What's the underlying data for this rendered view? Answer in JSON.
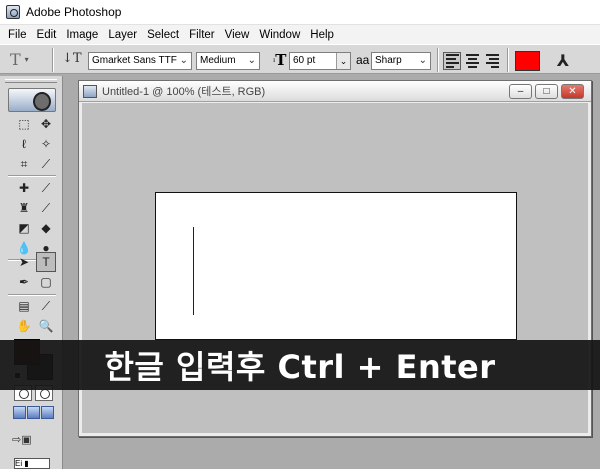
{
  "app": {
    "title": "Adobe Photoshop"
  },
  "menu": [
    "File",
    "Edit",
    "Image",
    "Layer",
    "Select",
    "Filter",
    "View",
    "Window",
    "Help"
  ],
  "options": {
    "tool_preset_glyph": "T",
    "orientation_glyph": "↓T",
    "font_family": "Gmarket Sans TTF",
    "font_style": "Medium",
    "size_glyph": "T",
    "font_size": "60 pt",
    "aa_glyph": "aa",
    "antialias": "Sharp",
    "text_color": "#ff0000",
    "warp_glyph": "⅄"
  },
  "document": {
    "title": "Untitled-1 @ 100% (테스트, RGB)",
    "minimize": "–",
    "maximize": "□",
    "close": "✕",
    "canvas_color": "#ffffff"
  },
  "colors": {
    "foreground": "#4a0606",
    "background": "#2a2a2a"
  },
  "caption": "한글 입력후 Ctrl + Enter"
}
